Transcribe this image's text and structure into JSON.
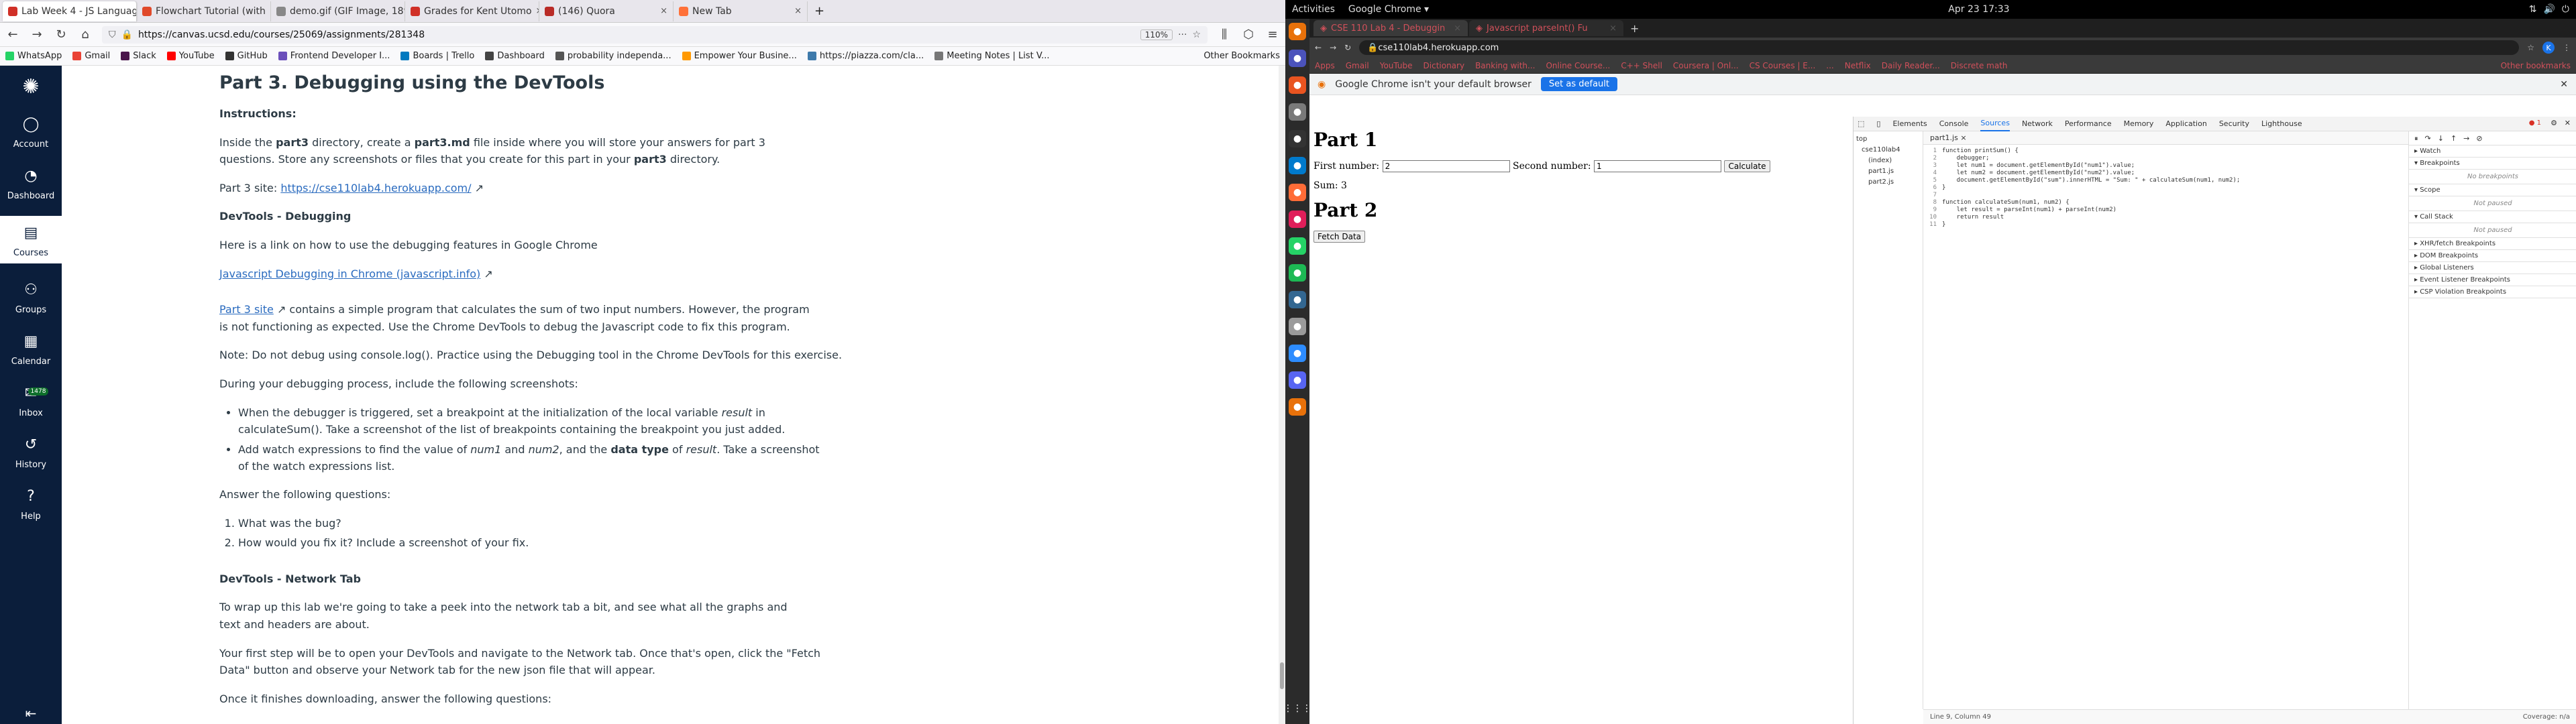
{
  "firefox": {
    "tabs": [
      {
        "label": "Lab Week 4 - JS Languag",
        "color": "#d03027",
        "active": true
      },
      {
        "label": "Flowchart Tutorial (with",
        "color": "#e0492a"
      },
      {
        "label": "demo.gif (GIF Image, 1895 ×",
        "color": "#888888"
      },
      {
        "label": "Grades for Kent Utomo",
        "color": "#d03027"
      },
      {
        "label": "(146) Quora",
        "color": "#b92b27"
      },
      {
        "label": "New Tab",
        "color": "#ff7139"
      }
    ],
    "new_tab": "+",
    "url": "https://canvas.ucsd.edu/courses/25069/assignments/281348",
    "zoom": "110%",
    "bookmarks": [
      {
        "label": "WhatsApp",
        "color": "#25d366"
      },
      {
        "label": "Gmail",
        "color": "#ea4335"
      },
      {
        "label": "Slack",
        "color": "#4a154b"
      },
      {
        "label": "YouTube",
        "color": "#ff0000"
      },
      {
        "label": "GitHub",
        "color": "#333333"
      },
      {
        "label": "Frontend Developer I...",
        "color": "#6b4fbb"
      },
      {
        "label": "Boards | Trello",
        "color": "#0079bf"
      },
      {
        "label": "Dashboard",
        "color": "#444444"
      },
      {
        "label": "probability independa...",
        "color": "#555555"
      },
      {
        "label": "Empower Your Busine...",
        "color": "#ff9900"
      },
      {
        "label": "https://piazza.com/cla...",
        "color": "#3e7aab"
      },
      {
        "label": "Meeting Notes | List V...",
        "color": "#777777"
      }
    ],
    "other_bookmarks": "Other Bookmarks"
  },
  "canvas_nav": [
    {
      "label": "Account",
      "icon": "account-icon"
    },
    {
      "label": "Dashboard",
      "icon": "dashboard-icon"
    },
    {
      "label": "Courses",
      "icon": "courses-icon",
      "active": true
    },
    {
      "label": "Groups",
      "icon": "groups-icon"
    },
    {
      "label": "Calendar",
      "icon": "calendar-icon"
    },
    {
      "label": "Inbox",
      "icon": "inbox-icon",
      "badge": "1478"
    },
    {
      "label": "History",
      "icon": "history-icon"
    },
    {
      "label": "Help",
      "icon": "help-icon"
    }
  ],
  "assignment": {
    "title": "Part 3. Debugging using the DevTools",
    "instructions_heading": "Instructions:",
    "intro_a": "Inside the ",
    "intro_b": "part3",
    "intro_c": " directory, create a ",
    "intro_d": "part3.md",
    "intro_e": " file inside where you will store your answers for part 3 questions. Store any screenshots or files that you create for this part in your ",
    "intro_f": "part3",
    "intro_g": " directory.",
    "site_label": "Part 3 site: ",
    "site_link": "https://cse110lab4.herokuapp.com/",
    "debug_heading": "DevTools - Debugging",
    "debug_para": "Here is a link on how to use the debugging features in Google Chrome",
    "debug_link": "Javascript Debugging in Chrome (javascript.info)",
    "p3_link": "Part 3 site",
    "p3_text": " contains a simple program that calculates the sum of two input numbers. However, the program is not functioning as expected. Use the Chrome DevTools to debug the Javascript code to fix this program.",
    "note": "Note: Do not debug using console.log(). Practice using the Debugging tool in the Chrome DevTools for this exercise.",
    "during": "During your debugging process, include the following screenshots:",
    "bullet1_a": "When the debugger is triggered, set a breakpoint at the initialization of the local variable ",
    "bullet1_b": "result",
    "bullet1_c": " in calculateSum(). Take a screenshot of the list of breakpoints containing the breakpoint you just added.",
    "bullet2_a": "Add watch expressions to find the value of ",
    "bullet2_b": "num1",
    "bullet2_c": " and ",
    "bullet2_d": "num2",
    "bullet2_e": ", and the ",
    "bullet2_f": "data type",
    "bullet2_g": " of ",
    "bullet2_h": "result",
    "bullet2_i": ". Take a screenshot of the watch expressions list.",
    "answer": "Answer the following questions:",
    "q1": "What was the bug?",
    "q2": "How would you fix it? Include a screenshot of your fix.",
    "network_heading": "DevTools - Network Tab",
    "network_p1": "To wrap up this lab we're going to take a peek into the network tab a bit, and see what all the graphs and text and headers are about.",
    "network_p2": "Your first step will be to open your DevTools and navigate to the Network tab. Once that's open, click the \"Fetch Data\" button and observe your Network tab for the new json file that will appear.",
    "network_p3": "Once it finishes downloading, answer the following questions:"
  },
  "gnome": {
    "activities": "Activities",
    "app": "Google Chrome ▾",
    "clock": "Apr 23  17:33"
  },
  "dock": [
    {
      "icon": "chrome-icon",
      "color": "#e8710a"
    },
    {
      "icon": "teams-icon",
      "color": "#4b53bc"
    },
    {
      "icon": "software-icon",
      "color": "#e95420"
    },
    {
      "icon": "files-icon",
      "color": "#7a7a7a"
    },
    {
      "icon": "terminal-icon",
      "color": "#333333"
    },
    {
      "icon": "vscode-icon",
      "color": "#007acc"
    },
    {
      "icon": "postman-icon",
      "color": "#ff6c37"
    },
    {
      "icon": "slack-icon",
      "color": "#e01e5a"
    },
    {
      "icon": "whatsapp-icon",
      "color": "#25d366"
    },
    {
      "icon": "spotify-icon",
      "color": "#1db954"
    },
    {
      "icon": "postgres-icon",
      "color": "#336791"
    },
    {
      "icon": "notes-icon",
      "color": "#9a9a9a"
    },
    {
      "icon": "zoom-icon",
      "color": "#2d8cff"
    },
    {
      "icon": "discord-icon",
      "color": "#5865f2"
    },
    {
      "icon": "chrome-active-icon",
      "color": "#e8710a"
    }
  ],
  "apps_grid": "⋮⋮⋮",
  "chrome": {
    "tabs": [
      {
        "label": "CSE 110 Lab 4 - Debuggin",
        "active": true
      },
      {
        "label": "Javascript parseInt() Fu"
      }
    ],
    "new_tab": "+",
    "url": "cse110lab4.herokuapp.com",
    "bookmarks": [
      "Apps",
      "Gmail",
      "YouTube",
      "Dictionary",
      "Banking with...",
      "Online Course...",
      "C++ Shell",
      "Coursera | Onl...",
      "CS Courses | E...",
      "...",
      "Netflix",
      "Daily Reader...",
      "Discrete math"
    ],
    "other_bookmarks": "Other bookmarks",
    "info_text": "Google Chrome isn't your default browser",
    "info_button": "Set as default"
  },
  "page": {
    "part1": "Part 1",
    "first_label": "First number:",
    "first_value": "2",
    "second_label": "Second number:",
    "second_value": "1",
    "calc_button": "Calculate",
    "sum": "Sum: 3",
    "part2": "Part 2",
    "fetch_button": "Fetch Data"
  },
  "devtools": {
    "tabs": [
      "Elements",
      "Console",
      "Sources",
      "Network",
      "Performance",
      "Memory",
      "Application",
      "Security",
      "Lighthouse"
    ],
    "active_tab": "Sources",
    "tree": [
      "top",
      "cse110lab4",
      "(index)",
      "part1.js",
      "part2.js"
    ],
    "file": "part1.js ×",
    "code": [
      "function printSum() {",
      "    debugger;",
      "    let num1 = document.getElementById(\"num1\").value;",
      "    let num2 = document.getElementById(\"num2\").value;",
      "    document.getElementById(\"sum\").innerHTML = \"Sum: \" + calculateSum(num1, num2);",
      "}",
      "",
      "function calculateSum(num1, num2) {",
      "    let result = parseInt(num1) + parseInt(num2)",
      "    return result",
      "}"
    ],
    "sections": [
      {
        "label": "▸ Watch"
      },
      {
        "label": "▾ Breakpoints",
        "empty": "No breakpoints"
      },
      {
        "label": "▾ Scope",
        "empty": "Not paused"
      },
      {
        "label": "▾ Call Stack",
        "empty": "Not paused"
      },
      {
        "label": "▸ XHR/fetch Breakpoints"
      },
      {
        "label": "▸ DOM Breakpoints"
      },
      {
        "label": "▸ Global Listeners"
      },
      {
        "label": "▸ Event Listener Breakpoints"
      },
      {
        "label": "▸ CSP Violation Breakpoints"
      }
    ],
    "status": "Line 9, Column 49",
    "coverage": "Coverage: n/a",
    "error_count": "1"
  }
}
